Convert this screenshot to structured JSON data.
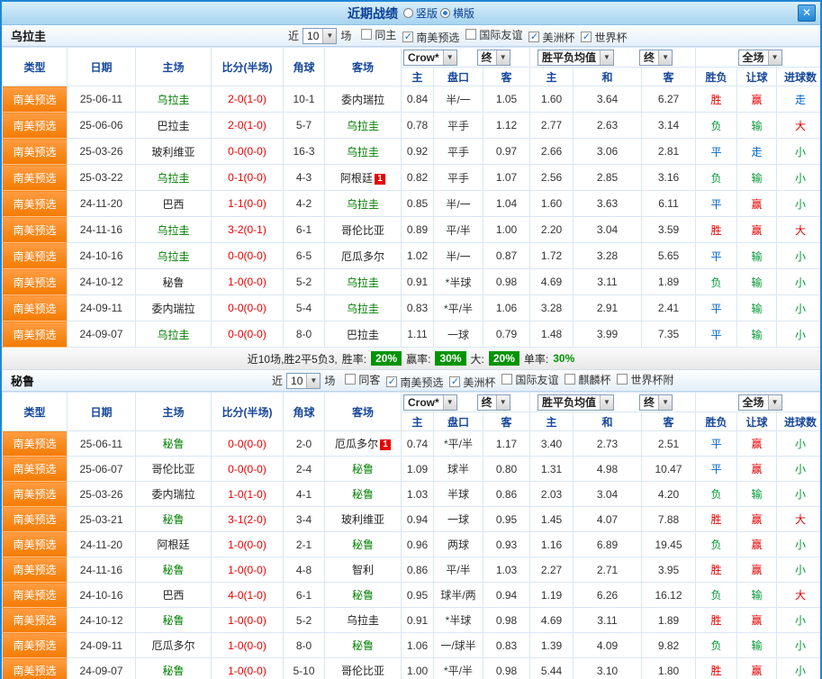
{
  "window": {
    "title": "近期战绩",
    "layout_vertical": "竖版",
    "layout_horizontal": "横版",
    "close_label": "✕"
  },
  "filter_labels": {
    "near": "近",
    "games": "场",
    "near_count": "10"
  },
  "selects": {
    "company": "Crow*",
    "final1": "终",
    "avg": "胜平负均值",
    "final2": "终",
    "scope": "全场"
  },
  "columns": {
    "type": "类型",
    "date": "日期",
    "home": "主场",
    "score": "比分(半场)",
    "corner": "角球",
    "away": "客场",
    "asia_home": "主",
    "handicap": "盘口",
    "asia_away": "客",
    "euro_home": "主",
    "euro_draw": "和",
    "euro_away": "客",
    "wdl": "胜负",
    "let_goal": "让球",
    "goals": "进球数"
  },
  "sections": [
    {
      "team": "乌拉圭",
      "checkboxes": [
        {
          "label": "同主",
          "checked": false
        },
        {
          "label": "南美预选",
          "checked": true
        },
        {
          "label": "国际友谊",
          "checked": false
        },
        {
          "label": "美洲杯",
          "checked": true
        },
        {
          "label": "世界杯",
          "checked": true
        }
      ],
      "rows": [
        {
          "type": "南美预选",
          "date": "25-06-11",
          "home": "乌拉圭",
          "home_focus": true,
          "score": "2-0(1-0)",
          "corner": "10-1",
          "away": "委内瑞拉",
          "away_focus": false,
          "away_badge": "",
          "ah": "0.84",
          "hcap": "半/一",
          "aa": "1.05",
          "ew": "1.60",
          "ed": "3.64",
          "el": "6.27",
          "wdl": "胜",
          "let": "赢",
          "goal": "走"
        },
        {
          "type": "南美预选",
          "date": "25-06-06",
          "home": "巴拉圭",
          "home_focus": false,
          "score": "2-0(1-0)",
          "corner": "5-7",
          "away": "乌拉圭",
          "away_focus": true,
          "away_badge": "",
          "ah": "0.78",
          "hcap": "平手",
          "aa": "1.12",
          "ew": "2.77",
          "ed": "2.63",
          "el": "3.14",
          "wdl": "负",
          "let": "输",
          "goal": "大"
        },
        {
          "type": "南美预选",
          "date": "25-03-26",
          "home": "玻利维亚",
          "home_focus": false,
          "score": "0-0(0-0)",
          "corner": "16-3",
          "away": "乌拉圭",
          "away_focus": true,
          "away_badge": "",
          "ah": "0.92",
          "hcap": "平手",
          "aa": "0.97",
          "ew": "2.66",
          "ed": "3.06",
          "el": "2.81",
          "wdl": "平",
          "let": "走",
          "goal": "小"
        },
        {
          "type": "南美预选",
          "date": "25-03-22",
          "home": "乌拉圭",
          "home_focus": true,
          "score": "0-1(0-0)",
          "corner": "4-3",
          "away": "阿根廷",
          "away_focus": false,
          "away_badge": "1",
          "ah": "0.82",
          "hcap": "平手",
          "aa": "1.07",
          "ew": "2.56",
          "ed": "2.85",
          "el": "3.16",
          "wdl": "负",
          "let": "输",
          "goal": "小"
        },
        {
          "type": "南美预选",
          "date": "24-11-20",
          "home": "巴西",
          "home_focus": false,
          "score": "1-1(0-0)",
          "corner": "4-2",
          "away": "乌拉圭",
          "away_focus": true,
          "away_badge": "",
          "ah": "0.85",
          "hcap": "半/一",
          "aa": "1.04",
          "ew": "1.60",
          "ed": "3.63",
          "el": "6.11",
          "wdl": "平",
          "let": "赢",
          "goal": "小"
        },
        {
          "type": "南美预选",
          "date": "24-11-16",
          "home": "乌拉圭",
          "home_focus": true,
          "score": "3-2(0-1)",
          "corner": "6-1",
          "away": "哥伦比亚",
          "away_focus": false,
          "away_badge": "",
          "ah": "0.89",
          "hcap": "平/半",
          "aa": "1.00",
          "ew": "2.20",
          "ed": "3.04",
          "el": "3.59",
          "wdl": "胜",
          "let": "赢",
          "goal": "大"
        },
        {
          "type": "南美预选",
          "date": "24-10-16",
          "home": "乌拉圭",
          "home_focus": true,
          "score": "0-0(0-0)",
          "corner": "6-5",
          "away": "厄瓜多尔",
          "away_focus": false,
          "away_badge": "",
          "ah": "1.02",
          "hcap": "半/一",
          "aa": "0.87",
          "ew": "1.72",
          "ed": "3.28",
          "el": "5.65",
          "wdl": "平",
          "let": "输",
          "goal": "小"
        },
        {
          "type": "南美预选",
          "date": "24-10-12",
          "home": "秘鲁",
          "home_focus": false,
          "score": "1-0(0-0)",
          "corner": "5-2",
          "away": "乌拉圭",
          "away_focus": true,
          "away_badge": "",
          "ah": "0.91",
          "hcap": "*半球",
          "aa": "0.98",
          "ew": "4.69",
          "ed": "3.11",
          "el": "1.89",
          "wdl": "负",
          "let": "输",
          "goal": "小"
        },
        {
          "type": "南美预选",
          "date": "24-09-11",
          "home": "委内瑞拉",
          "home_focus": false,
          "score": "0-0(0-0)",
          "corner": "5-4",
          "away": "乌拉圭",
          "away_focus": true,
          "away_badge": "",
          "ah": "0.83",
          "hcap": "*平/半",
          "aa": "1.06",
          "ew": "3.28",
          "ed": "2.91",
          "el": "2.41",
          "wdl": "平",
          "let": "输",
          "goal": "小"
        },
        {
          "type": "南美预选",
          "date": "24-09-07",
          "home": "乌拉圭",
          "home_focus": true,
          "score": "0-0(0-0)",
          "corner": "8-0",
          "away": "巴拉圭",
          "away_focus": false,
          "away_badge": "",
          "ah": "1.11",
          "hcap": "一球",
          "aa": "0.79",
          "ew": "1.48",
          "ed": "3.99",
          "el": "7.35",
          "wdl": "平",
          "let": "输",
          "goal": "小"
        }
      ],
      "summary": {
        "prefix": "近10场,胜2平5负3,",
        "win_rate_label": "胜率:",
        "win_rate": "20%",
        "cover_rate_label": "赢率:",
        "cover_rate": "30%",
        "big_label": "大:",
        "big_rate": "20%",
        "single_label": "单率:",
        "single_rate": "30%"
      }
    },
    {
      "team": "秘鲁",
      "checkboxes": [
        {
          "label": "同客",
          "checked": false
        },
        {
          "label": "南美预选",
          "checked": true
        },
        {
          "label": "美洲杯",
          "checked": true
        },
        {
          "label": "国际友谊",
          "checked": false
        },
        {
          "label": "麒麟杯",
          "checked": false
        },
        {
          "label": "世界杯附",
          "checked": false
        }
      ],
      "rows": [
        {
          "type": "南美预选",
          "date": "25-06-11",
          "home": "秘鲁",
          "home_focus": true,
          "score": "0-0(0-0)",
          "corner": "2-0",
          "away": "厄瓜多尔",
          "away_focus": false,
          "away_badge": "1",
          "ah": "0.74",
          "hcap": "*平/半",
          "aa": "1.17",
          "ew": "3.40",
          "ed": "2.73",
          "el": "2.51",
          "wdl": "平",
          "let": "赢",
          "goal": "小"
        },
        {
          "type": "南美预选",
          "date": "25-06-07",
          "home": "哥伦比亚",
          "home_focus": false,
          "score": "0-0(0-0)",
          "corner": "2-4",
          "away": "秘鲁",
          "away_focus": true,
          "away_badge": "",
          "ah": "1.09",
          "hcap": "球半",
          "aa": "0.80",
          "ew": "1.31",
          "ed": "4.98",
          "el": "10.47",
          "wdl": "平",
          "let": "赢",
          "goal": "小"
        },
        {
          "type": "南美预选",
          "date": "25-03-26",
          "home": "委内瑞拉",
          "home_focus": false,
          "score": "1-0(1-0)",
          "corner": "4-1",
          "away": "秘鲁",
          "away_focus": true,
          "away_badge": "",
          "ah": "1.03",
          "hcap": "半球",
          "aa": "0.86",
          "ew": "2.03",
          "ed": "3.04",
          "el": "4.20",
          "wdl": "负",
          "let": "输",
          "goal": "小"
        },
        {
          "type": "南美预选",
          "date": "25-03-21",
          "home": "秘鲁",
          "home_focus": true,
          "score": "3-1(2-0)",
          "corner": "3-4",
          "away": "玻利维亚",
          "away_focus": false,
          "away_badge": "",
          "ah": "0.94",
          "hcap": "一球",
          "aa": "0.95",
          "ew": "1.45",
          "ed": "4.07",
          "el": "7.88",
          "wdl": "胜",
          "let": "赢",
          "goal": "大"
        },
        {
          "type": "南美预选",
          "date": "24-11-20",
          "home": "阿根廷",
          "home_focus": false,
          "score": "1-0(0-0)",
          "corner": "2-1",
          "away": "秘鲁",
          "away_focus": true,
          "away_badge": "",
          "ah": "0.96",
          "hcap": "两球",
          "aa": "0.93",
          "ew": "1.16",
          "ed": "6.89",
          "el": "19.45",
          "wdl": "负",
          "let": "赢",
          "goal": "小"
        },
        {
          "type": "南美预选",
          "date": "24-11-16",
          "home": "秘鲁",
          "home_focus": true,
          "score": "1-0(0-0)",
          "corner": "4-8",
          "away": "智利",
          "away_focus": false,
          "away_badge": "",
          "ah": "0.86",
          "hcap": "平/半",
          "aa": "1.03",
          "ew": "2.27",
          "ed": "2.71",
          "el": "3.95",
          "wdl": "胜",
          "let": "赢",
          "goal": "小"
        },
        {
          "type": "南美预选",
          "date": "24-10-16",
          "home": "巴西",
          "home_focus": false,
          "score": "4-0(1-0)",
          "corner": "6-1",
          "away": "秘鲁",
          "away_focus": true,
          "away_badge": "",
          "ah": "0.95",
          "hcap": "球半/两",
          "aa": "0.94",
          "ew": "1.19",
          "ed": "6.26",
          "el": "16.12",
          "wdl": "负",
          "let": "输",
          "goal": "大"
        },
        {
          "type": "南美预选",
          "date": "24-10-12",
          "home": "秘鲁",
          "home_focus": true,
          "score": "1-0(0-0)",
          "corner": "5-2",
          "away": "乌拉圭",
          "away_focus": false,
          "away_badge": "",
          "ah": "0.91",
          "hcap": "*半球",
          "aa": "0.98",
          "ew": "4.69",
          "ed": "3.11",
          "el": "1.89",
          "wdl": "胜",
          "let": "赢",
          "goal": "小"
        },
        {
          "type": "南美预选",
          "date": "24-09-11",
          "home": "厄瓜多尔",
          "home_focus": false,
          "score": "1-0(0-0)",
          "corner": "8-0",
          "away": "秘鲁",
          "away_focus": true,
          "away_badge": "",
          "ah": "1.06",
          "hcap": "一/球半",
          "aa": "0.83",
          "ew": "1.39",
          "ed": "4.09",
          "el": "9.82",
          "wdl": "负",
          "let": "输",
          "goal": "小"
        },
        {
          "type": "南美预选",
          "date": "24-09-07",
          "home": "秘鲁",
          "home_focus": true,
          "score": "1-0(0-0)",
          "corner": "5-10",
          "away": "哥伦比亚",
          "away_focus": false,
          "away_badge": "",
          "ah": "1.00",
          "hcap": "*平/半",
          "aa": "0.98",
          "ew": "5.44",
          "ed": "3.10",
          "el": "1.80",
          "wdl": "胜",
          "let": "赢",
          "goal": "小"
        }
      ]
    }
  ]
}
